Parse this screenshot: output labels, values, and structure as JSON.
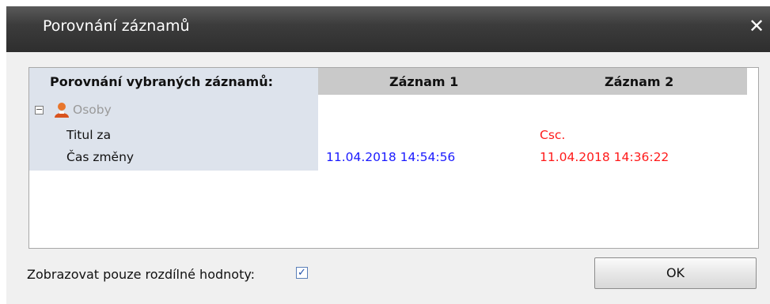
{
  "window": {
    "title": "Porovnání záznamů",
    "close_label": "✕"
  },
  "grid": {
    "headers": [
      "Porovnání vybraných záznamů:",
      "Záznam 1",
      "Záznam 2"
    ],
    "group": {
      "label": "Osoby",
      "icon": "person-icon",
      "collapse_icon": "collapse-minus-icon"
    },
    "rows": [
      {
        "field": "Titul za",
        "record1": "",
        "record2": "Csc."
      },
      {
        "field": "Čas změny",
        "record1": "11.04.2018 14:54:56",
        "record2": "11.04.2018 14:36:22"
      }
    ],
    "colors": {
      "record1": "#1a1aff",
      "record2": "#ff1a1a",
      "group_label": "#9a9a9a",
      "left_column_bg": "#dde3ec",
      "header_bg": "#c9c9c9"
    }
  },
  "footer": {
    "checkbox_label": "Zobrazovat pouze rozdílné hodnoty:",
    "checkbox_checked": true,
    "ok_label": "OK"
  }
}
